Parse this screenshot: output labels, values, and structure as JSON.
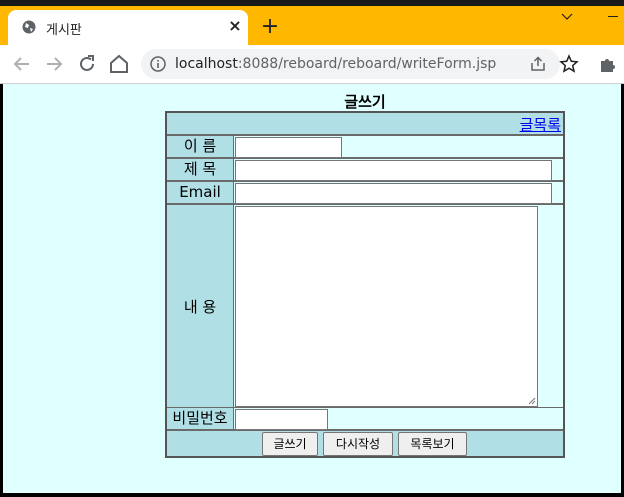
{
  "browser": {
    "tab_title": "게시판",
    "tab_close": "×",
    "new_tab": "+",
    "url_host": "localhost",
    "url_rest": ":8088/reboard/reboard/writeForm.jsp",
    "accent": "#ffb700"
  },
  "form": {
    "title": "글쓰기",
    "list_link": "글목록",
    "name_label": "이 름",
    "subject_label": "제 목",
    "email_label": "Email",
    "content_label": "내 용",
    "password_label": "비밀번호",
    "submit_label": "글쓰기",
    "reset_label": "다시작성",
    "list_button_label": "목록보기",
    "header_color": "#b0e0e6",
    "page_bg": "#e0ffff"
  }
}
